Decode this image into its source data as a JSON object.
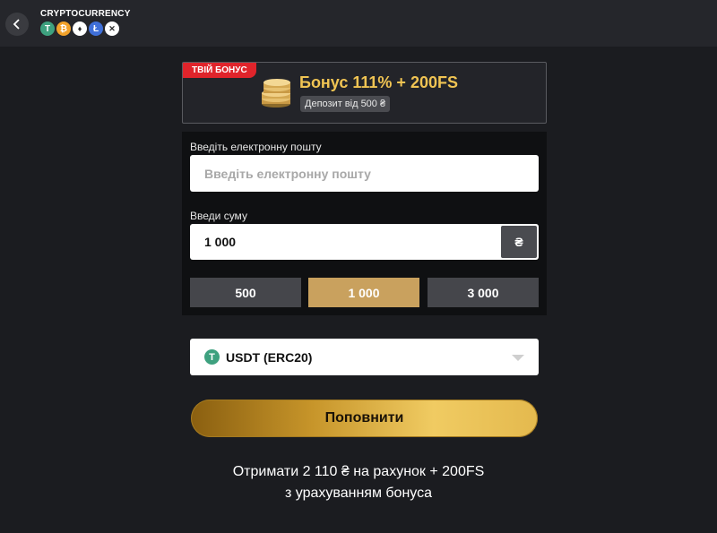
{
  "header": {
    "title": "CRYPTOCURRENCY",
    "coins": [
      {
        "icon": "tether-icon",
        "symbol": "T",
        "color": "#3ea17f"
      },
      {
        "icon": "bitcoin-icon",
        "symbol": "₿",
        "color": "#f2a22a"
      },
      {
        "icon": "ethereum-icon",
        "symbol": "♦",
        "color": "#ffffff"
      },
      {
        "icon": "litecoin-icon",
        "symbol": "Ł",
        "color": "#3f6fd8"
      },
      {
        "icon": "ripple-icon",
        "symbol": "✕",
        "color": "#ffffff"
      }
    ]
  },
  "bonus": {
    "tag": "ТВІЙ БОНУС",
    "title": "Бонус 111% + 200FS",
    "min_deposit": "Депозит від 500 ₴"
  },
  "form": {
    "email_label": "Введіть електронну пошту",
    "email_placeholder": "Введіть електронну пошту",
    "amount_label": "Введи суму",
    "amount_value": "1 000",
    "currency_symbol": "₴",
    "presets": [
      "500",
      "1 000",
      "3 000"
    ]
  },
  "payment_method": {
    "selected": "USDT (ERC20)"
  },
  "submit_label": "Поповнити",
  "receive": {
    "line1": "Отримати 2 110 ₴ на рахунок + 200FS",
    "line2": "з урахуванням бонуса"
  }
}
